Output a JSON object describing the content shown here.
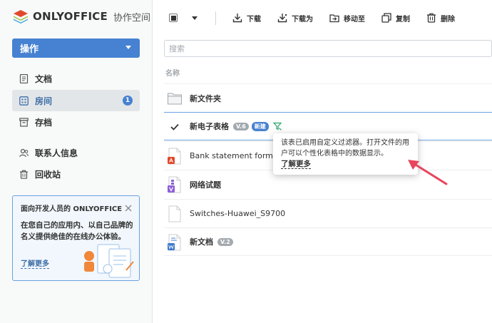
{
  "app": {
    "logo_text": "ONLYOFFICE",
    "logo_sub": "协作空间"
  },
  "sidebar": {
    "actions_label": "操作",
    "items": [
      {
        "label": "文档",
        "icon": "document-icon"
      },
      {
        "label": "房间",
        "icon": "rooms-icon",
        "badge": "1",
        "active": true
      },
      {
        "label": "存档",
        "icon": "archive-icon"
      },
      {
        "label": "联系人信息",
        "icon": "contacts-icon"
      },
      {
        "label": "回收站",
        "icon": "trash-icon"
      }
    ],
    "promo": {
      "title": "面向开发人员的 ONLYOFFICE",
      "body": "在您自己的应用内、以自己品牌的名义提供绝佳的在线办公体验。",
      "link": "了解更多"
    }
  },
  "toolbar": {
    "download": "下载",
    "download_as": "下载为",
    "move_to": "移动至",
    "copy": "复制",
    "delete": "删除"
  },
  "search": {
    "placeholder": "搜索"
  },
  "table": {
    "column_name": "名称",
    "rows": [
      {
        "name": "新文件夹",
        "type": "folder"
      },
      {
        "name": "新电子表格",
        "type": "spreadsheet",
        "version": "V.6",
        "tag": "新建",
        "selected": true
      },
      {
        "name": "Bank statement form",
        "type": "pdf"
      },
      {
        "name": "网络试题",
        "type": "form"
      },
      {
        "name": "Switches-Huawei_S9700",
        "type": "blank"
      },
      {
        "name": "新文档",
        "type": "word",
        "version": "V.2"
      }
    ]
  },
  "tooltip": {
    "text": "该表已启用自定义过滤器。打开文件的用户可以个性化表格中的数据显示。",
    "link": "了解更多"
  },
  "colors": {
    "accent": "#4781d1",
    "annotation_arrow": "#e8455e"
  }
}
